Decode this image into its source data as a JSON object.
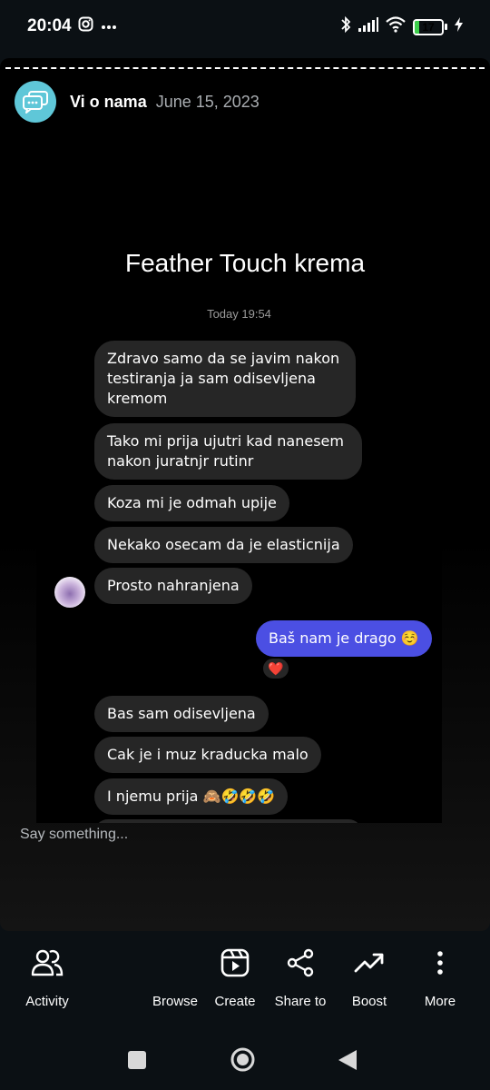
{
  "status_bar": {
    "time": "20:04",
    "battery": "17"
  },
  "story": {
    "account_name": "Vi o nama",
    "date": "June 15, 2023",
    "title": "Feather Touch krema",
    "chat": {
      "timestamp": "Today 19:54",
      "received_1": [
        "Zdravo samo da se javim nakon testiranja ja sam odisevljena kremom",
        "Tako mi prija ujutri kad nanesem nakon juratnjr rutinr",
        "Koza mi je odmah upije",
        "Nekako osecam da je elasticnija",
        "Prosto nahranjena"
      ],
      "sent": "Baš nam je drago ☺️",
      "reaction": "❤️",
      "received_2": [
        "Bas sam odisevljena",
        "Cak je i muz kraducka malo",
        "I njemu prija 🙈🤣🤣🤣"
      ]
    }
  },
  "reply": {
    "placeholder": "Say something..."
  },
  "bottom_nav": [
    {
      "label": "Activity",
      "icon": "people-icon"
    },
    {
      "label": "Browse",
      "icon": ""
    },
    {
      "label": "Create",
      "icon": "reels-icon"
    },
    {
      "label": "Share to",
      "icon": "share-icon"
    },
    {
      "label": "Boost",
      "icon": "trending-icon"
    },
    {
      "label": "More",
      "icon": "more-vertical-icon"
    }
  ]
}
